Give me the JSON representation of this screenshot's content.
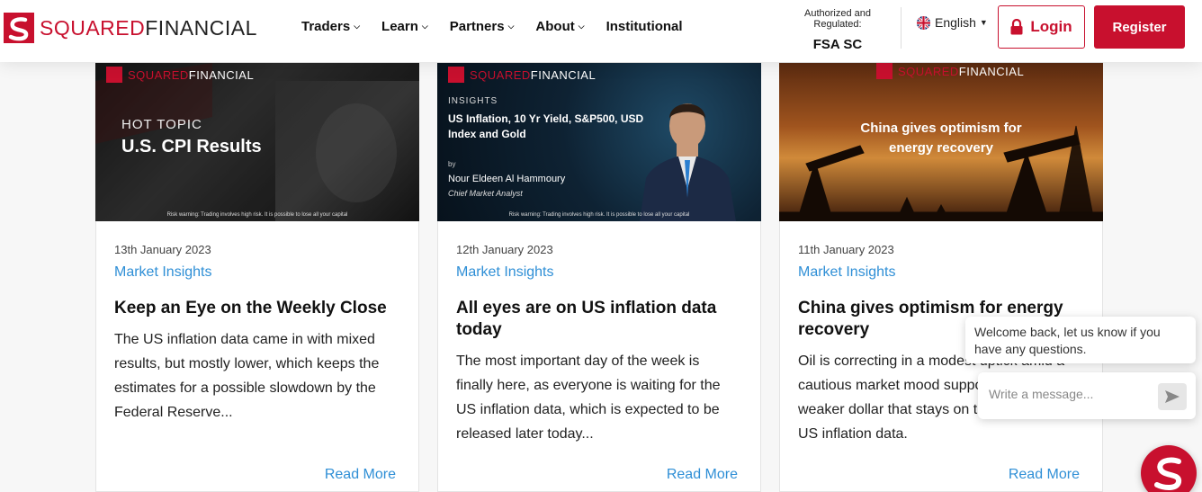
{
  "header": {
    "logo_part1": "SQUARED",
    "logo_part2": "FINANCIAL",
    "nav": [
      {
        "label": "Traders"
      },
      {
        "label": "Learn"
      },
      {
        "label": "Partners"
      },
      {
        "label": "About"
      },
      {
        "label": "Institutional"
      }
    ],
    "regulation_label": "Authorized and Regulated:",
    "regulator": "FSA SC",
    "language": "English",
    "login_label": "Login",
    "register_label": "Register"
  },
  "cards": [
    {
      "image": {
        "brand1": "SQUARED",
        "brand2": "FINANCIAL",
        "kicker": "HOT TOPIC",
        "headline": "U.S. CPI Results",
        "risk": "Risk warning: Trading involves high risk. It is possible to lose all your capital"
      },
      "date": "13th January 2023",
      "category": "Market Insights",
      "title": "Keep an Eye on the Weekly Close",
      "excerpt": "The US inflation data came in with mixed results, but mostly lower, which keeps the estimates for a possible slowdown by the Federal Reserve...",
      "read_more": "Read More"
    },
    {
      "image": {
        "brand1": "SQUARED",
        "brand2": "FINANCIAL",
        "kicker": "INSIGHTS",
        "headline": "US Inflation, 10 Yr Yield, S&P500, USD Index and Gold",
        "by": "by",
        "author": "Nour Eldeen Al Hammoury",
        "role": "Chief Market Analyst",
        "risk": "Risk warning: Trading involves high risk. It is possible to lose all your capital"
      },
      "date": "12th January 2023",
      "category": "Market Insights",
      "title": "All eyes are on US inflation data today",
      "excerpt": "The most important day of the week is finally here, as everyone is waiting for the US inflation data, which is expected to be released later today...",
      "read_more": "Read More"
    },
    {
      "image": {
        "brand1": "SQUARED",
        "brand2": "FINANCIAL",
        "headline": "China gives optimism for energy recovery"
      },
      "date": "11th January 2023",
      "category": "Market Insights",
      "title": "China gives optimism for energy recovery",
      "excerpt": "Oil is correcting in a modest uptick amid a cautious market mood supported by a weaker dollar that stays on the ahead of US inflation data.",
      "read_more": "Read More"
    }
  ],
  "chat": {
    "greeting": "Welcome back, let us know if you have any questions.",
    "placeholder": "Write a message..."
  },
  "colors": {
    "brand_red": "#c8102e",
    "link_blue": "#2f8fd6"
  }
}
